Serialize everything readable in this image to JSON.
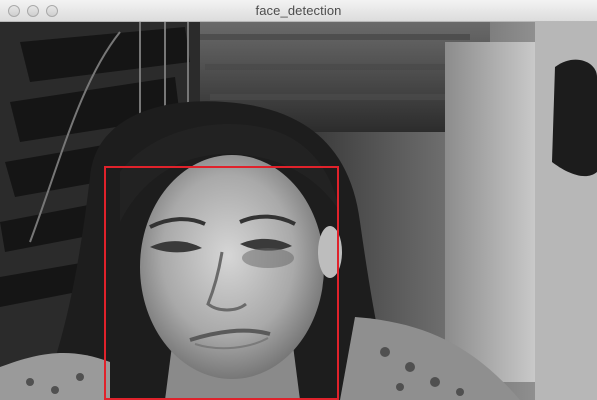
{
  "window": {
    "title": "face_detection",
    "controls": [
      "close",
      "minimize",
      "zoom"
    ]
  },
  "video": {
    "description_colors": {
      "detection_box": "#e0222b"
    }
  }
}
